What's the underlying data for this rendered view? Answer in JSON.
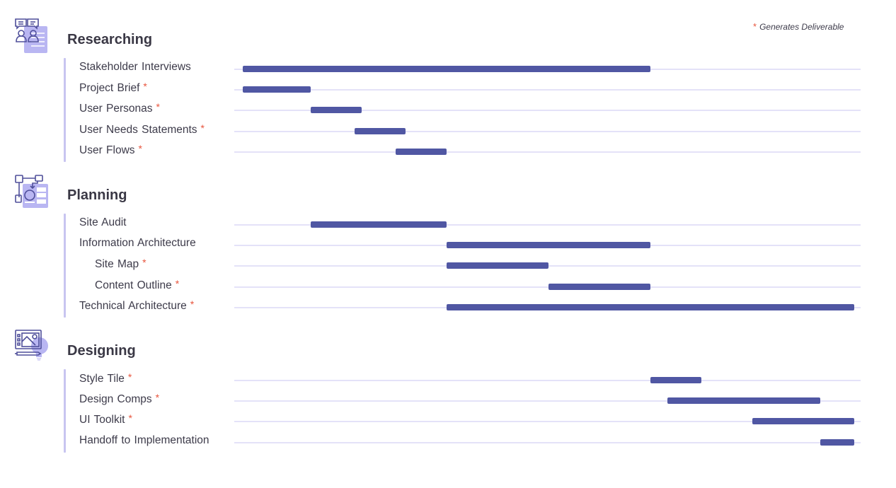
{
  "legend": {
    "marker": "*",
    "label": "Generates Deliverable"
  },
  "colors": {
    "bar": "#5057a3",
    "track": "#e4e2f8",
    "accent_line": "#c8c5f0",
    "deliverable_marker": "#e8553d",
    "icon_stroke": "#4f4f9a",
    "icon_fill": "#b9b6f2"
  },
  "chart_data": {
    "type": "gantt",
    "title": "",
    "time_axis": {
      "unit": "period",
      "range": [
        0,
        36
      ],
      "tick_labels": []
    },
    "legend": {
      "entries": [
        "* Generates Deliverable"
      ],
      "placement": "top-right"
    },
    "sections": [
      {
        "title": "Researching",
        "icon": "interview-persona-icon",
        "tasks": [
          {
            "label": "Stakeholder Interviews",
            "deliverable": false,
            "indent": 0,
            "start": 0,
            "end": 24
          },
          {
            "label": "Project Brief",
            "deliverable": true,
            "indent": 0,
            "start": 0,
            "end": 4
          },
          {
            "label": "User Personas",
            "deliverable": true,
            "indent": 0,
            "start": 4,
            "end": 7
          },
          {
            "label": "User Needs Statements",
            "deliverable": true,
            "indent": 0,
            "start": 6.6,
            "end": 9.6
          },
          {
            "label": "User Flows",
            "deliverable": true,
            "indent": 0,
            "start": 9,
            "end": 12
          }
        ]
      },
      {
        "title": "Planning",
        "icon": "sitemap-wireframe-icon",
        "tasks": [
          {
            "label": "Site Audit",
            "deliverable": false,
            "indent": 0,
            "start": 4,
            "end": 12
          },
          {
            "label": "Information Architecture",
            "deliverable": false,
            "indent": 0,
            "start": 12,
            "end": 24
          },
          {
            "label": "Site Map",
            "deliverable": true,
            "indent": 1,
            "start": 12,
            "end": 18
          },
          {
            "label": "Content Outline",
            "deliverable": true,
            "indent": 1,
            "start": 18,
            "end": 24
          },
          {
            "label": "Technical Architecture",
            "deliverable": true,
            "indent": 0,
            "start": 12,
            "end": 36
          }
        ]
      },
      {
        "title": "Designing",
        "icon": "design-tablet-icon",
        "tasks": [
          {
            "label": "Style Tile",
            "deliverable": true,
            "indent": 0,
            "start": 24,
            "end": 27
          },
          {
            "label": "Design Comps",
            "deliverable": true,
            "indent": 0,
            "start": 25,
            "end": 34
          },
          {
            "label": "UI Toolkit",
            "deliverable": true,
            "indent": 0,
            "start": 30,
            "end": 36
          },
          {
            "label": "Handoff to Implementation",
            "deliverable": false,
            "indent": 0,
            "start": 34,
            "end": 36
          }
        ]
      }
    ]
  }
}
